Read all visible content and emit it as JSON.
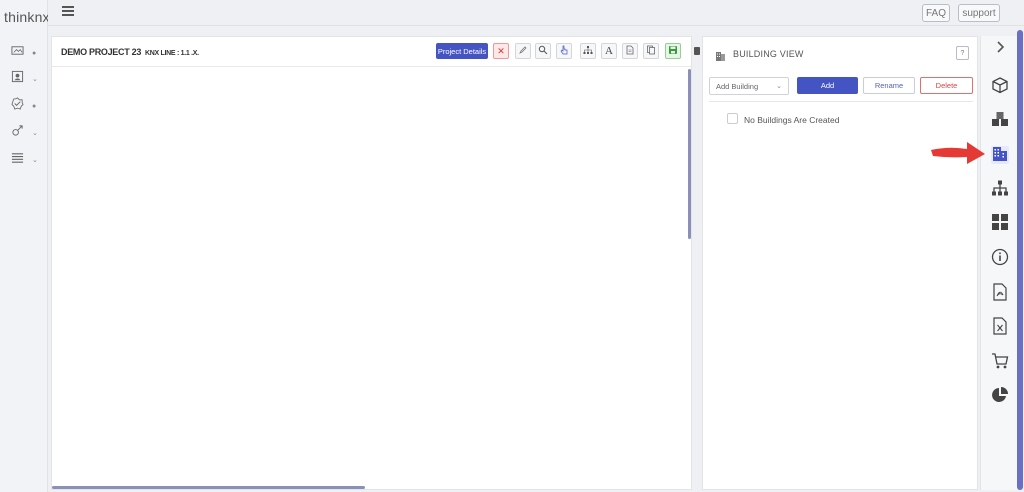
{
  "app": {
    "logo": "thinknx"
  },
  "topbar": {
    "faq_label": "FAQ",
    "support_label": "support"
  },
  "left_nav": {
    "items": [
      {
        "icon": "image-icon"
      },
      {
        "icon": "user-card-icon"
      },
      {
        "icon": "check-badge-icon"
      },
      {
        "icon": "gender-icon"
      },
      {
        "icon": "list-icon"
      }
    ]
  },
  "project": {
    "title": "DEMO PROJECT 23",
    "subtitle": "KNX LINE : 1.1 .X.",
    "details_label": "Project Details",
    "tools": [
      "close-icon",
      "pencil-icon",
      "search-icon",
      "pointer-icon",
      "hierarchy-icon",
      "text-icon",
      "document-icon",
      "copy-icon",
      "save-icon"
    ]
  },
  "building_view": {
    "title": "BUILDING VIEW",
    "help_label": "?",
    "select_placeholder": "Add Building",
    "add_label": "Add",
    "rename_label": "Rename",
    "delete_label": "Delete",
    "empty_message": "No Buildings Are Created"
  },
  "right_rail": {
    "items": [
      "chevron-right-icon",
      "cube-icon",
      "cubes-icon",
      "buildings-icon",
      "sitemap-icon",
      "grid-icon",
      "info-icon",
      "pdf-file-icon",
      "excel-file-icon",
      "cart-icon",
      "pie-chart-icon"
    ],
    "active": "buildings-icon"
  },
  "colors": {
    "accent": "#4454c3",
    "danger": "#d94545",
    "arrow": "#e53935"
  }
}
